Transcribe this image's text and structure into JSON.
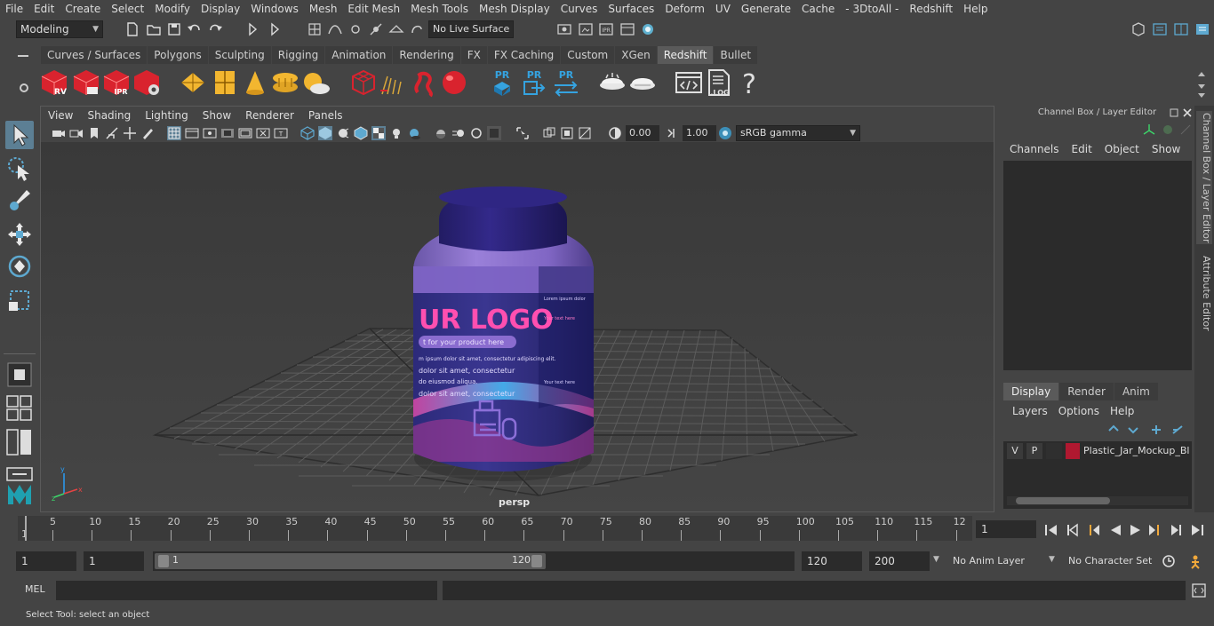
{
  "menu": [
    "File",
    "Edit",
    "Create",
    "Select",
    "Modify",
    "Display",
    "Windows",
    "Mesh",
    "Edit Mesh",
    "Mesh Tools",
    "Mesh Display",
    "Curves",
    "Surfaces",
    "Deform",
    "UV",
    "Generate",
    "Cache",
    "- 3DtoAll -",
    "Redshift",
    "Help"
  ],
  "status": {
    "workspace": "Modeling",
    "live_surface": "No Live Surface"
  },
  "shelf_tabs": [
    "Curves / Surfaces",
    "Polygons",
    "Sculpting",
    "Rigging",
    "Animation",
    "Rendering",
    "FX",
    "FX Caching",
    "Custom",
    "XGen",
    "Redshift",
    "Bullet"
  ],
  "shelf_active": "Redshift",
  "shelf_icon_labels": {
    "rv": "RV",
    "ipr": "IPR",
    "pr": "PR",
    "log": ".LOG",
    "help": "?"
  },
  "viewport": {
    "menu": [
      "View",
      "Shading",
      "Lighting",
      "Show",
      "Renderer",
      "Panels"
    ],
    "exposure": "0.00",
    "gamma": "1.00",
    "color_space": "sRGB gamma",
    "camera_label": "persp"
  },
  "jar_label": {
    "logo": "UR LOGO",
    "tagline": "t for your product here",
    "line1": "m ipsum dolor sit amet, consectetur adipiscing elit.",
    "line2": "dolor sit amet, consectetur",
    "line3": "do eiusmod aliqua.",
    "line4": "dolor sit amet, consectetur",
    "side1": "Lorem ipsum dolor",
    "side2": "Your text here",
    "side3": "Your text here"
  },
  "channel_box": {
    "title": "Channel Box / Layer Editor",
    "menu": [
      "Channels",
      "Edit",
      "Object",
      "Show"
    ]
  },
  "layer_editor": {
    "tabs": [
      "Display",
      "Render",
      "Anim"
    ],
    "active_tab": "Display",
    "menu": [
      "Layers",
      "Options",
      "Help"
    ],
    "layer": {
      "v": "V",
      "p": "P",
      "name": "Plastic_Jar_Mockup_Blu",
      "color": "#b01830"
    }
  },
  "side_tabs": [
    "Channel Box / Layer Editor",
    "Attribute Editor"
  ],
  "timeline": {
    "ticks": [
      "5",
      "10",
      "15",
      "20",
      "25",
      "30",
      "35",
      "40",
      "45",
      "50",
      "55",
      "60",
      "65",
      "70",
      "75",
      "80",
      "85",
      "90",
      "95",
      "100",
      "105",
      "110",
      "115",
      "12"
    ],
    "start_marker": "1",
    "current_frame": "1"
  },
  "range": {
    "start": "1",
    "playback_start": "1",
    "slider_start": "1",
    "slider_end": "120",
    "playback_end": "120",
    "end": "200",
    "anim_layer": "No Anim Layer",
    "character_set": "No Character Set"
  },
  "command": {
    "lang": "MEL"
  },
  "status_bar": "Select Tool: select an object",
  "colors": {
    "accent": "#5285a6",
    "redshift_red": "#d9232e",
    "jar_purple": "#8a6ccf",
    "cap": "#2a226e"
  }
}
